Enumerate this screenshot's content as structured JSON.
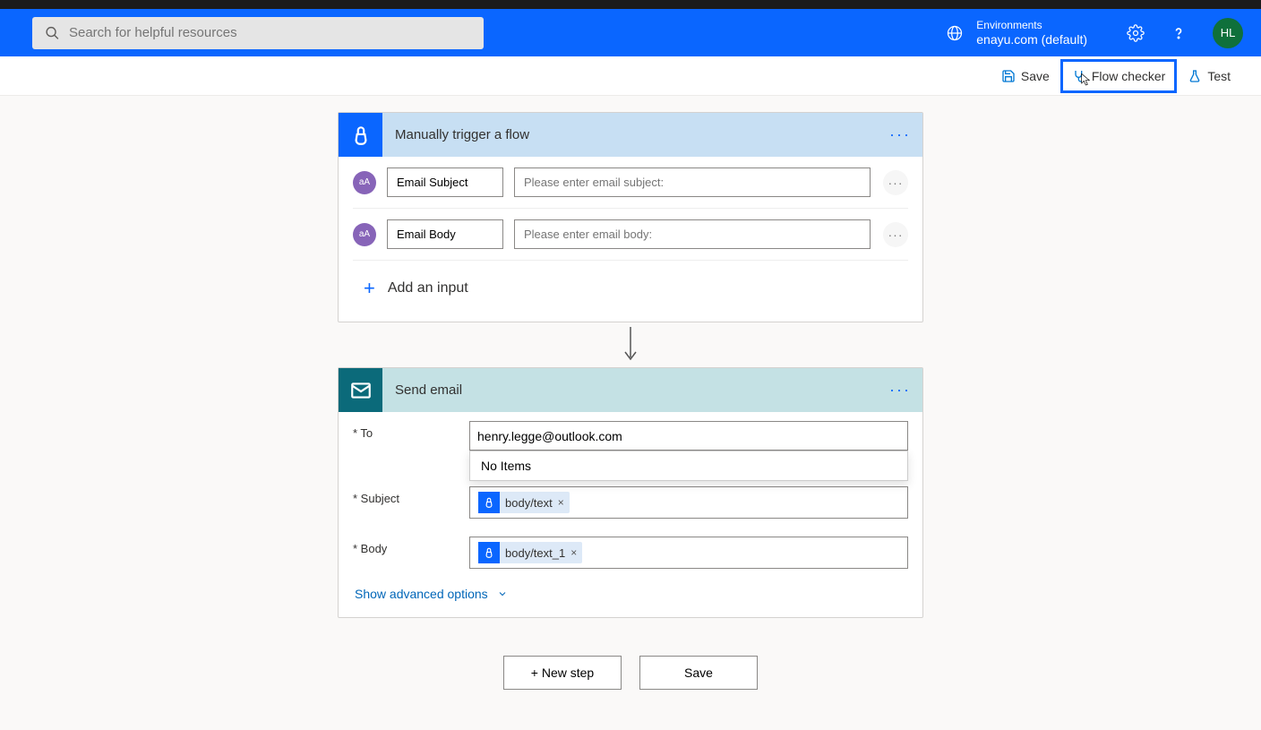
{
  "header": {
    "search_placeholder": "Search for helpful resources",
    "env_label": "Environments",
    "env_name": "enayu.com (default)",
    "avatar": "HL"
  },
  "toolbar": {
    "save": "Save",
    "flow_checker": "Flow checker",
    "test": "Test"
  },
  "trigger": {
    "title": "Manually trigger a flow",
    "inputs": [
      {
        "label": "Email Subject",
        "placeholder": "Please enter email subject:"
      },
      {
        "label": "Email Body",
        "placeholder": "Please enter email body:"
      }
    ],
    "add_input": "Add an input"
  },
  "action": {
    "title": "Send email",
    "to_label": "* To",
    "to_value": "henry.legge@outlook.com",
    "suggest_text": "No Items",
    "subject_label": "* Subject",
    "subject_token": "body/text",
    "body_label": "* Body",
    "body_token": "body/text_1",
    "advanced": "Show advanced options"
  },
  "footer": {
    "new_step": "+ New step",
    "save": "Save"
  },
  "param_badge": "aA"
}
